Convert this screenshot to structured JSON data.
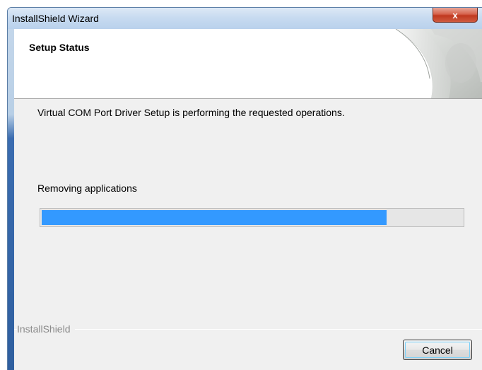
{
  "window": {
    "title": "InstallShield Wizard",
    "close_glyph": "x"
  },
  "header": {
    "title": "Setup Status"
  },
  "body": {
    "message": "Virtual COM Port Driver Setup is performing the requested operations.",
    "action": "Removing applications"
  },
  "progress": {
    "percent": 82
  },
  "branding": {
    "text": "InstallShield"
  },
  "buttons": {
    "cancel": "Cancel"
  },
  "colors": {
    "progress_fill": "#3399ff",
    "title_bar": "#c6daf0",
    "close_button": "#c0391f"
  },
  "icons": {
    "header_art": "page-curl-art",
    "close": "close-icon"
  }
}
